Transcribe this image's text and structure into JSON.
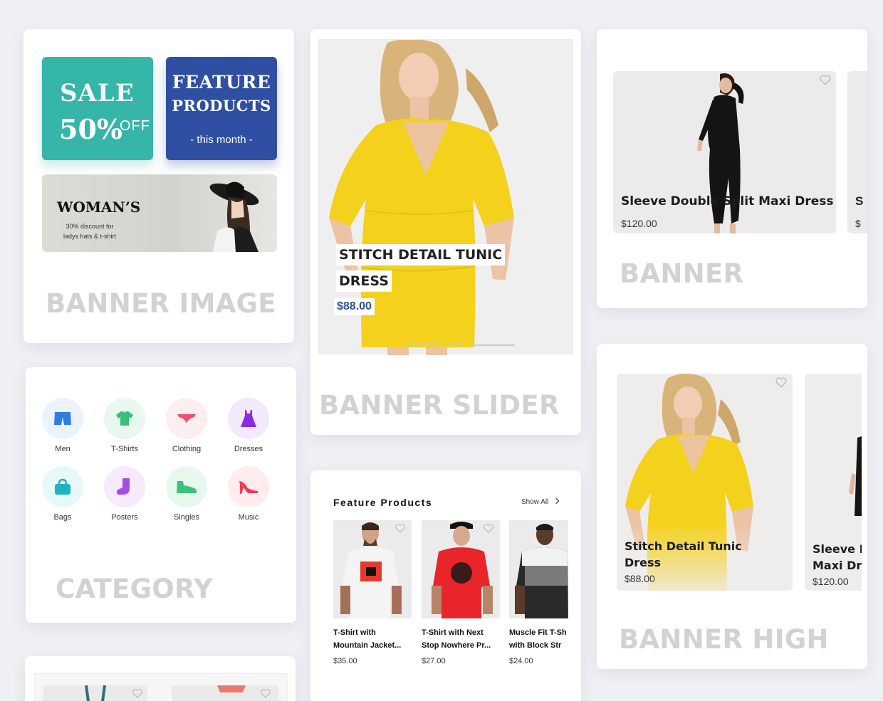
{
  "banner_image": {
    "sale": {
      "line1": "SALE",
      "percent": "50%",
      "off": "OFF",
      "color": "#36b5a9"
    },
    "feature": {
      "line1": "FEATURE",
      "line2": "PRODUCTS",
      "line3": "- this month -",
      "color": "#2f4fa3"
    },
    "woman": {
      "title": "WOMAN’S",
      "line1": "30% discount for",
      "line2": "ladys hats & t-shirt"
    },
    "caption": "BANNER IMAGE"
  },
  "banner_slider": {
    "title_line1": "STITCH DETAIL TUNIC",
    "title_line2": "DRESS",
    "price": "$88.00",
    "active_slide": 1,
    "slide_count": 3,
    "caption": "BANNER SLIDER"
  },
  "banner": {
    "product": {
      "name": "Sleeve Double Split Maxi Dress",
      "price": "$120.00",
      "icon": "heart-icon"
    },
    "caption": "BANNER"
  },
  "category": {
    "items": [
      {
        "label": "Men",
        "icon": "shorts-icon",
        "bg": "#eaf3ff",
        "color": "#2f7de1"
      },
      {
        "label": "T-Shirts",
        "icon": "tshirt-icon",
        "bg": "#e8f8ee",
        "color": "#36c07a"
      },
      {
        "label": "Clothing",
        "icon": "underwear-icon",
        "bg": "#fdeef0",
        "color": "#f0506e"
      },
      {
        "label": "Dresses",
        "icon": "dress-icon",
        "bg": "#f3e9fd",
        "color": "#8a2be2"
      },
      {
        "label": "Bags",
        "icon": "bag-icon",
        "bg": "#e6f8f8",
        "color": "#1fb3c2"
      },
      {
        "label": "Posters",
        "icon": "sock-icon",
        "bg": "#f5ebfd",
        "color": "#a64ee0"
      },
      {
        "label": "Singles",
        "icon": "shoe-icon",
        "bg": "#e7f9ef",
        "color": "#39c27c"
      },
      {
        "label": "Music",
        "icon": "heel-icon",
        "bg": "#feecee",
        "color": "#ef3c52"
      }
    ],
    "caption": "CATEGORY"
  },
  "feature_products": {
    "title": "Feature Products",
    "show_all": "Show All",
    "items": [
      {
        "line1": "T-Shirt with",
        "line2": "Mountain Jacket...",
        "price": "$35.00"
      },
      {
        "line1": "T-Shirt with Next",
        "line2": "Stop Nowhere Pr...",
        "price": "$27.00"
      },
      {
        "line1": "Muscle Fit T-Sh",
        "line2": "with Block Str",
        "price": "$24.00"
      }
    ]
  },
  "banner_high": {
    "products": [
      {
        "line1": "Stitch Detail Tunic",
        "line2": "Dress",
        "price": "$88.00"
      },
      {
        "line1": "Sleeve D",
        "line2": "Maxi Dre",
        "price": "$120.00"
      }
    ],
    "caption": "BANNER HIGH"
  }
}
